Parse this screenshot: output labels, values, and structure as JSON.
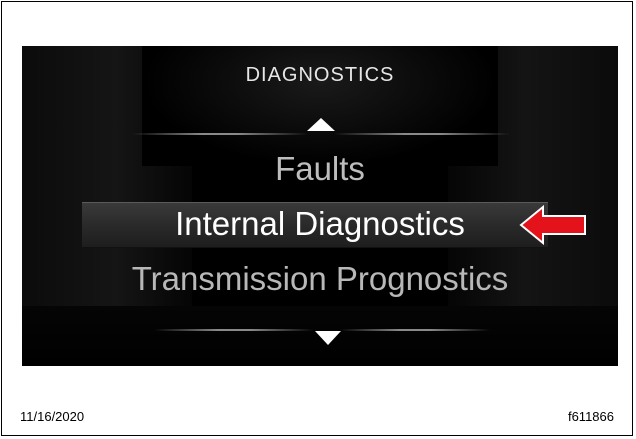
{
  "screen": {
    "title": "DIAGNOSTICS",
    "menu": [
      {
        "label": "Faults",
        "selected": false
      },
      {
        "label": "Internal Diagnostics",
        "selected": true
      },
      {
        "label": "Transmission Prognostics",
        "selected": false
      }
    ],
    "scroll_up_icon": "triangle-up-icon",
    "scroll_down_icon": "triangle-down-icon",
    "pointer_icon": "red-arrow-left-icon",
    "colors": {
      "screen_bg": "#000000",
      "selected_text": "#ffffff",
      "pointer": "#e3121b"
    }
  },
  "footer": {
    "date": "11/16/2020",
    "figure_id": "f611866"
  }
}
